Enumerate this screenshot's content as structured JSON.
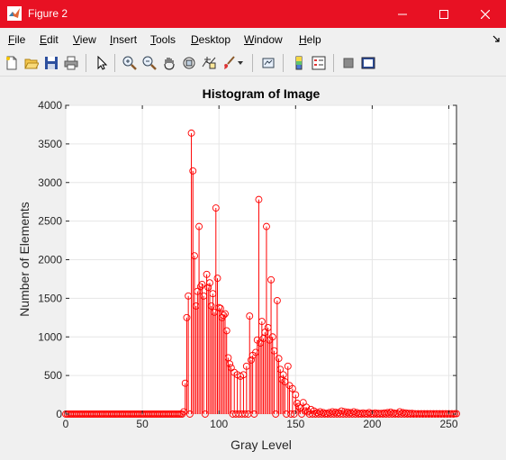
{
  "window": {
    "title": "Figure 2",
    "accent": "#e81123",
    "app_icon": "matlab-logo-icon"
  },
  "menu": [
    {
      "key": "F",
      "rest": "ile"
    },
    {
      "key": "E",
      "rest": "dit"
    },
    {
      "key": "V",
      "rest": "iew"
    },
    {
      "key": "I",
      "rest": "nsert"
    },
    {
      "key": "T",
      "rest": "ools"
    },
    {
      "key": "D",
      "rest": "esktop"
    },
    {
      "key": "W",
      "rest": "indow"
    },
    {
      "key": "H",
      "rest": "elp"
    }
  ],
  "toolbar": [
    "new-figure-icon",
    "open-file-icon",
    "save-icon",
    "print-icon",
    "arrow-cursor-icon",
    "zoom-in-icon",
    "zoom-out-icon",
    "pan-hand-icon",
    "rotate-3d-icon",
    "data-cursor-icon",
    "brush-icon",
    "link-plot-icon",
    "colorbar-icon",
    "legend-icon",
    "hide-plot-tools-icon",
    "show-plot-tools-icon"
  ],
  "chart_data": {
    "type": "stem",
    "title": "Histogram of Image",
    "xlabel": "Gray Level",
    "ylabel": "Number of Elements",
    "xlim": [
      0,
      255
    ],
    "ylim": [
      0,
      4000
    ],
    "xticks": [
      0,
      50,
      100,
      150,
      200,
      250
    ],
    "yticks": [
      0,
      500,
      1000,
      1500,
      2000,
      2500,
      3000,
      3500,
      4000
    ],
    "grid": true,
    "color": "#ff0000",
    "points": [
      [
        77,
        30
      ],
      [
        78,
        400
      ],
      [
        79,
        1250
      ],
      [
        80,
        1530
      ],
      [
        82,
        3640
      ],
      [
        83,
        3150
      ],
      [
        84,
        2050
      ],
      [
        85,
        1400
      ],
      [
        86,
        1590
      ],
      [
        87,
        2430
      ],
      [
        88,
        1650
      ],
      [
        89,
        1680
      ],
      [
        90,
        1530
      ],
      [
        92,
        1810
      ],
      [
        93,
        1640
      ],
      [
        94,
        1700
      ],
      [
        95,
        1400
      ],
      [
        96,
        1560
      ],
      [
        97,
        1320
      ],
      [
        98,
        2670
      ],
      [
        99,
        1760
      ],
      [
        100,
        1380
      ],
      [
        101,
        1370
      ],
      [
        102,
        1250
      ],
      [
        103,
        1280
      ],
      [
        104,
        1300
      ],
      [
        105,
        1080
      ],
      [
        106,
        730
      ],
      [
        107,
        650
      ],
      [
        108,
        600
      ],
      [
        110,
        540
      ],
      [
        112,
        510
      ],
      [
        114,
        490
      ],
      [
        116,
        510
      ],
      [
        118,
        620
      ],
      [
        120,
        1270
      ],
      [
        121,
        700
      ],
      [
        122,
        760
      ],
      [
        124,
        800
      ],
      [
        125,
        960
      ],
      [
        126,
        2780
      ],
      [
        127,
        920
      ],
      [
        128,
        1200
      ],
      [
        129,
        980
      ],
      [
        130,
        1060
      ],
      [
        131,
        2430
      ],
      [
        132,
        1120
      ],
      [
        133,
        960
      ],
      [
        134,
        1740
      ],
      [
        135,
        1000
      ],
      [
        136,
        820
      ],
      [
        138,
        1470
      ],
      [
        139,
        720
      ],
      [
        140,
        580
      ],
      [
        141,
        450
      ],
      [
        142,
        510
      ],
      [
        143,
        420
      ],
      [
        145,
        620
      ],
      [
        146,
        370
      ],
      [
        148,
        330
      ],
      [
        150,
        250
      ],
      [
        151,
        140
      ],
      [
        152,
        100
      ],
      [
        153,
        80
      ],
      [
        155,
        150
      ],
      [
        156,
        40
      ],
      [
        157,
        90
      ],
      [
        158,
        30
      ],
      [
        160,
        60
      ],
      [
        162,
        40
      ],
      [
        164,
        20
      ],
      [
        166,
        30
      ],
      [
        168,
        20
      ],
      [
        170,
        10
      ],
      [
        172,
        20
      ],
      [
        174,
        30
      ],
      [
        176,
        25
      ],
      [
        178,
        20
      ],
      [
        180,
        40
      ],
      [
        182,
        30
      ],
      [
        184,
        25
      ],
      [
        186,
        20
      ],
      [
        188,
        30
      ],
      [
        190,
        20
      ],
      [
        192,
        10
      ],
      [
        194,
        15
      ],
      [
        196,
        10
      ],
      [
        198,
        20
      ],
      [
        200,
        10
      ],
      [
        202,
        15
      ],
      [
        204,
        10
      ],
      [
        206,
        10
      ],
      [
        208,
        15
      ],
      [
        210,
        20
      ],
      [
        212,
        25
      ],
      [
        214,
        15
      ],
      [
        216,
        10
      ],
      [
        218,
        30
      ],
      [
        220,
        20
      ],
      [
        222,
        15
      ],
      [
        224,
        10
      ],
      [
        226,
        10
      ],
      [
        228,
        5
      ],
      [
        230,
        5
      ],
      [
        232,
        5
      ],
      [
        234,
        5
      ],
      [
        236,
        5
      ],
      [
        238,
        5
      ],
      [
        240,
        5
      ],
      [
        242,
        5
      ],
      [
        244,
        5
      ],
      [
        246,
        5
      ],
      [
        248,
        5
      ],
      [
        250,
        5
      ],
      [
        252,
        5
      ],
      [
        254,
        5
      ],
      [
        255,
        5
      ]
    ]
  }
}
